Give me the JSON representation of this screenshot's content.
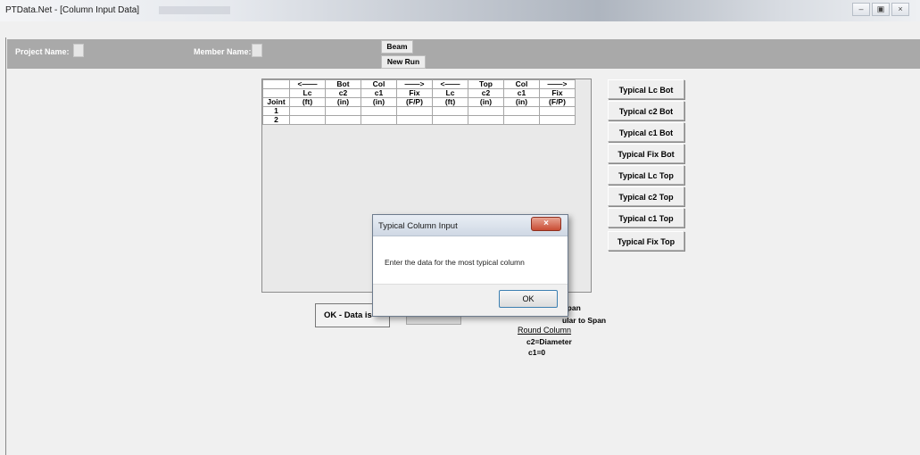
{
  "window": {
    "title": "PTData.Net - [Column Input Data]",
    "controls": [
      "–",
      "▣",
      "×"
    ]
  },
  "header": {
    "project_label": "Project Name:",
    "member_label": "Member Name:",
    "beam_button": "Beam",
    "new_run_button": "New Run"
  },
  "grid": {
    "header_row1": [
      "",
      "<——",
      "Bot",
      "Col",
      "——>",
      "<——",
      "Top",
      "Col",
      "——>"
    ],
    "header_row2": [
      "",
      "Lc",
      "c2",
      "c1",
      "Fix",
      "Lc",
      "c2",
      "c1",
      "Fix"
    ],
    "header_row3": [
      "Joint",
      "(ft)",
      "(in)",
      "(in)",
      "(F/P)",
      "(ft)",
      "(in)",
      "(in)",
      "(F/P)"
    ],
    "rows": [
      {
        "joint": "1"
      },
      {
        "joint": "2"
      }
    ]
  },
  "typical_buttons": [
    "Typical Lc Bot",
    "Typical c2 Bot",
    "Typical c1 Bot",
    "Typical Fix Bot",
    "Typical Lc Top",
    "Typical c2 Top",
    "Typical c1 Top",
    "Typical Fix Top"
  ],
  "bottom": {
    "ok_button": "OK - Data is",
    "notes": {
      "span_fragment": "Span",
      "perp_fragment": "ular to Span",
      "round_column": "Round Column",
      "c2_diameter": "c2=Diameter",
      "c1_zero": "c1=0"
    }
  },
  "dialog": {
    "title": "Typical Column Input",
    "close": "×",
    "message": "Enter the data for the most typical column",
    "ok": "OK"
  }
}
